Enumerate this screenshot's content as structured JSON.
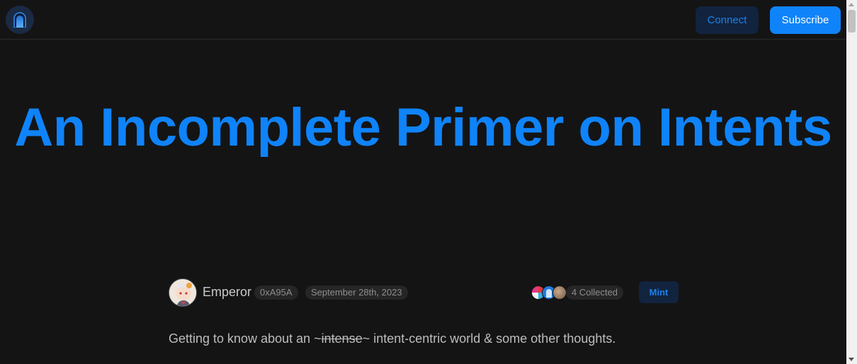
{
  "header": {
    "logo_icon": "arch-portal-icon",
    "connect_label": "Connect",
    "subscribe_label": "Subscribe"
  },
  "article": {
    "title": "An Incomplete Primer on Intents",
    "author": {
      "name": "Emperor",
      "address": "0xA95A"
    },
    "date": "September 28th, 2023",
    "collected": "4 Collected",
    "mint_label": "Mint",
    "subtitle": {
      "before": "Getting to know about an ~",
      "struck": "intense",
      "after": "~ intent-centric world & some other thoughts."
    }
  },
  "colors": {
    "background": "#141414",
    "accent": "#0f83f9",
    "accent_dark": "#11233e",
    "pill_bg": "#262626"
  }
}
